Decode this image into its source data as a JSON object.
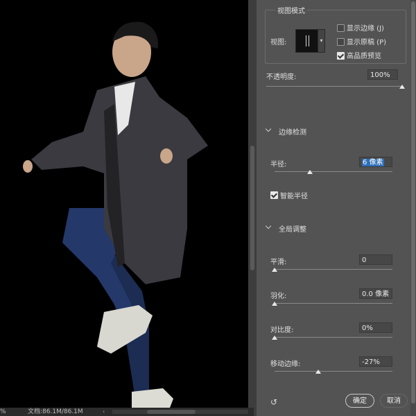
{
  "status": {
    "zoom": "%",
    "doc": "文档:86.1M/86.1M",
    "arrow": "‹"
  },
  "view_mode": {
    "legend": "视图模式",
    "view_label": "视图:",
    "options": [
      {
        "label": "显示边缘 (J)",
        "checked": false
      },
      {
        "label": "显示原稿 (P)",
        "checked": false
      },
      {
        "label": "高品质预览",
        "checked": true
      }
    ]
  },
  "opacity": {
    "label": "不透明度:",
    "value": "100%",
    "level": 1.0
  },
  "edge_detection": {
    "title": "边缘检测",
    "radius_label": "半径:",
    "radius_value": "6 像素",
    "radius_level": 0.3,
    "smart_radius_label": "智能半径",
    "smart_radius_checked": true
  },
  "global_refine": {
    "title": "全局调整",
    "smooth_label": "平滑:",
    "smooth_value": "0",
    "smooth_level": 0,
    "feather_label": "羽化:",
    "feather_value": "0.0 像素",
    "feather_level": 0,
    "contrast_label": "对比度:",
    "contrast_value": "0%",
    "contrast_level": 0,
    "shift_label": "移动边缘:",
    "shift_value": "-27%",
    "shift_level": 0.37
  },
  "buttons": {
    "ok": "确定",
    "cancel": "取消",
    "reset": "↺"
  }
}
